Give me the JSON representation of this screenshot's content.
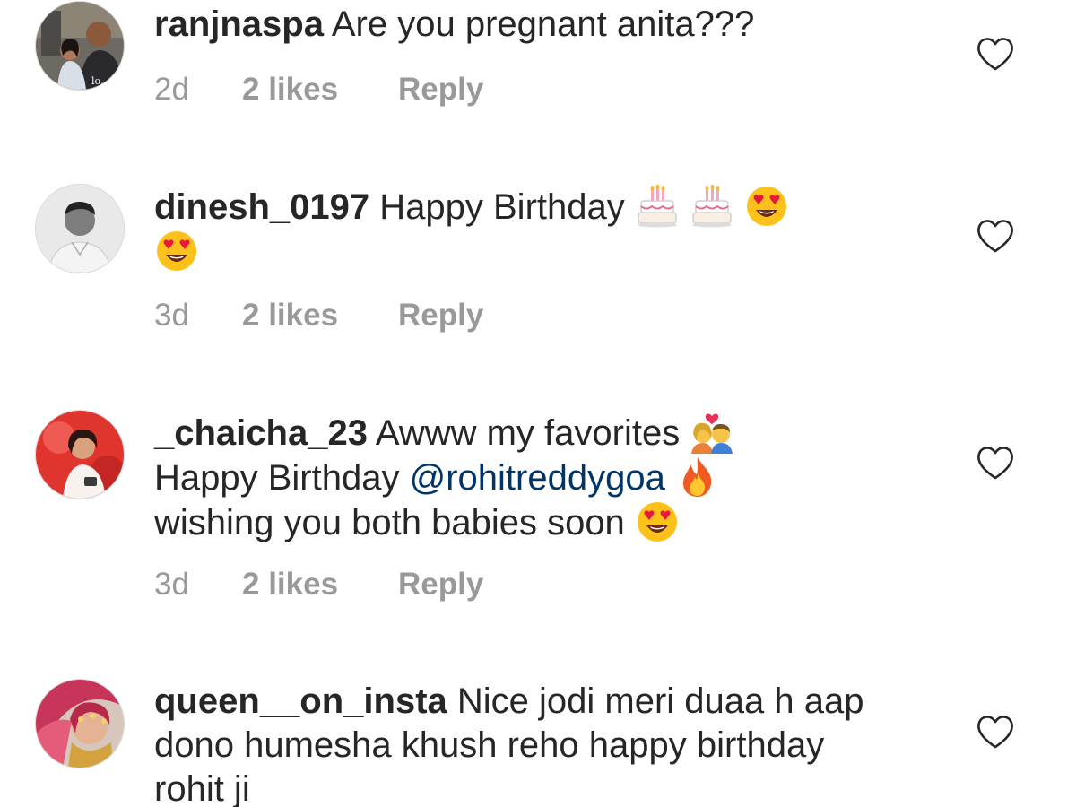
{
  "comments": [
    {
      "username": "ranjnaspa",
      "text": "Are you pregnant anita???",
      "age": "2d",
      "likes": "2 likes",
      "reply": "Reply"
    },
    {
      "username": "dinesh_0197",
      "text": "Happy Birthday",
      "emojis": [
        "birthday-cake-emoji",
        "birthday-cake-emoji",
        "heart-eyes-emoji",
        "heart-eyes-emoji"
      ],
      "age": "3d",
      "likes": "2 likes",
      "reply": "Reply"
    },
    {
      "username": "_chaicha_23",
      "text_1": "Awww my favorites",
      "text_2": "Happy Birthday",
      "mention": "@rohitreddygoa",
      "text_3": "wishing you both babies soon",
      "emojis": [
        "kiss-couple-emoji",
        "fire-emoji",
        "heart-eyes-emoji"
      ],
      "age": "3d",
      "likes": "2 likes",
      "reply": "Reply"
    },
    {
      "username": "queen__on_insta",
      "text": "Nice jodi meri duaa h aap dono humesha khush reho happy birthday rohit ji"
    }
  ],
  "icons": {
    "like": "heart-outline-icon"
  },
  "colors": {
    "text": "#262626",
    "meta": "#999999",
    "mention": "#003569",
    "heart_stroke": "#262626"
  }
}
